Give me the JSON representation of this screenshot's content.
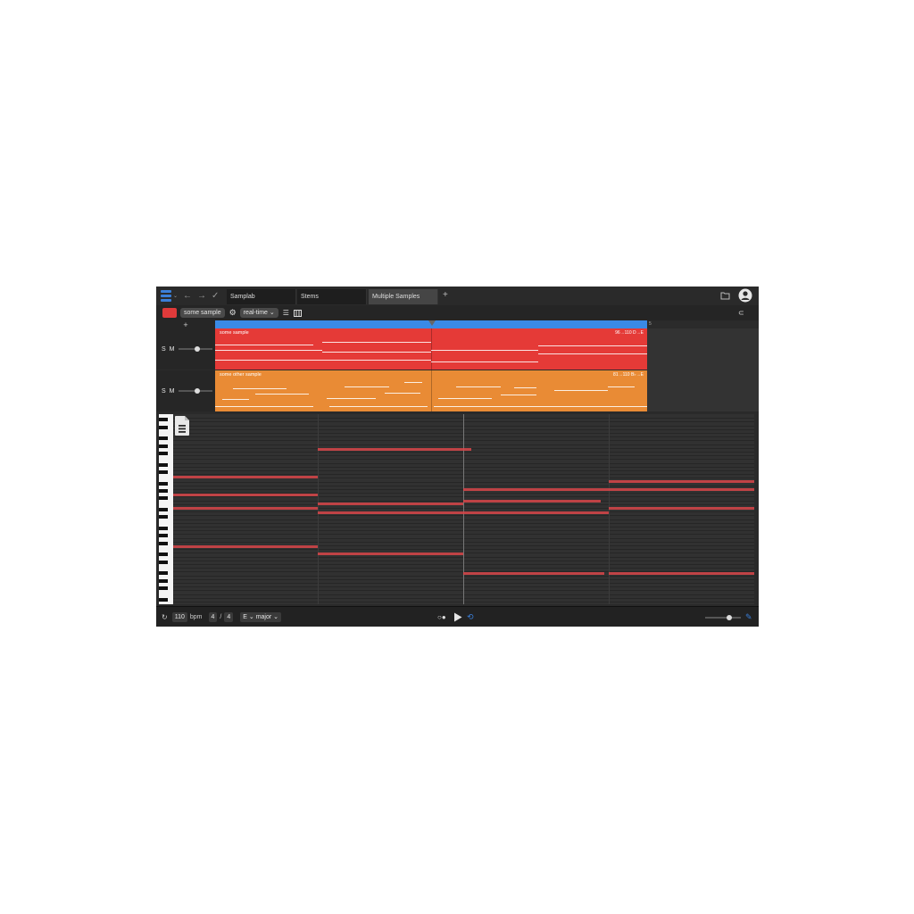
{
  "titlebar": {
    "tabs": [
      {
        "label": "Samplab"
      },
      {
        "label": "Stems"
      },
      {
        "label": "Multiple Samples",
        "active": true
      }
    ],
    "new_tab": "+",
    "icons": [
      "menu-logo-icon",
      "undo-icon",
      "redo-icon",
      "check-icon",
      "folder-icon",
      "account-icon"
    ]
  },
  "toolbar": {
    "color": "#e03a3a",
    "sample_name": "some sample",
    "mode": "real-time",
    "mode_chevron": "⌄",
    "icons": [
      "gear-icon",
      "list-icon",
      "piano-icon",
      "magnet-icon"
    ]
  },
  "tracks": {
    "add_label": "+",
    "ruler_marker": "5",
    "items": [
      {
        "sm_label": "S M",
        "clip_name": "some sample",
        "meta": "96→110 D→E",
        "color": "#e53a37"
      },
      {
        "sm_label": "S M",
        "clip_name": "some other sample",
        "meta": "81→110 B♭→E",
        "color": "#e98b35"
      }
    ]
  },
  "transport": {
    "bpm_value": "110",
    "bpm_label": "bpm",
    "time_sig_num": "4",
    "time_sig_sep": "/",
    "time_sig_den": "4",
    "key": "E",
    "scale": "major",
    "icons": [
      "loop-icon",
      "metronome-icon",
      "play-icon",
      "repeat-icon",
      "edit-icon"
    ]
  },
  "colors": {
    "accent": "#3b7fd9",
    "clip_red": "#e53a37",
    "clip_orange": "#e98b35",
    "note": "#d9464a"
  }
}
